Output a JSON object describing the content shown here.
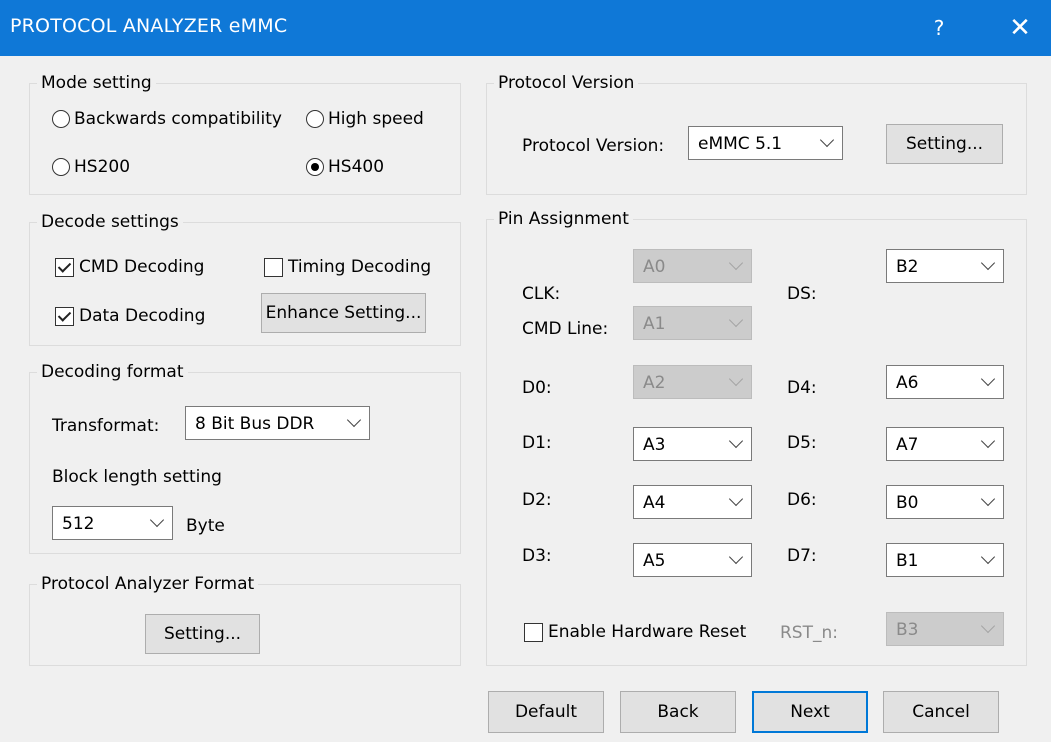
{
  "window": {
    "title": "PROTOCOL ANALYZER eMMC",
    "help_glyph": "?",
    "close_glyph": "✕"
  },
  "mode_setting": {
    "title": "Mode setting",
    "options": [
      "Backwards compatibility",
      "High speed",
      "HS200",
      "HS400"
    ],
    "selected": "HS400"
  },
  "decode_settings": {
    "title": "Decode settings",
    "cmd_decoding": {
      "label": "CMD Decoding",
      "checked": true
    },
    "timing_decoding": {
      "label": "Timing Decoding",
      "checked": false
    },
    "data_decoding": {
      "label": "Data Decoding",
      "checked": true
    },
    "enhance_button": "Enhance Setting..."
  },
  "decoding_format": {
    "title": "Decoding format",
    "transformat_label": "Transformat:",
    "transformat_value": "8 Bit Bus DDR",
    "block_length_label": "Block length setting",
    "block_length_value": "512",
    "block_unit": "Byte"
  },
  "protocol_analyzer_format": {
    "title": "Protocol Analyzer Format",
    "setting_button": "Setting..."
  },
  "protocol_version": {
    "title": "Protocol Version",
    "label": "Protocol Version:",
    "value": "eMMC 5.1",
    "setting_button": "Setting..."
  },
  "pin_assignment": {
    "title": "Pin Assignment",
    "clk": {
      "label": "CLK:",
      "value": "A0"
    },
    "ds": {
      "label": "DS:",
      "value": "B2"
    },
    "cmd_line": {
      "label": "CMD Line:",
      "value": "A1"
    },
    "d0": {
      "label": "D0:",
      "value": "A2"
    },
    "d1": {
      "label": "D1:",
      "value": "A3"
    },
    "d2": {
      "label": "D2:",
      "value": "A4"
    },
    "d3": {
      "label": "D3:",
      "value": "A5"
    },
    "d4": {
      "label": "D4:",
      "value": "A6"
    },
    "d5": {
      "label": "D5:",
      "value": "A7"
    },
    "d6": {
      "label": "D6:",
      "value": "B0"
    },
    "d7": {
      "label": "D7:",
      "value": "B1"
    },
    "enable_hw_reset": {
      "label": "Enable Hardware Reset",
      "checked": false
    },
    "rst_n": {
      "label": "RST_n:",
      "value": "B3"
    }
  },
  "footer": {
    "default": "Default",
    "back": "Back",
    "next": "Next",
    "cancel": "Cancel"
  },
  "colors": {
    "titlebar": "#0f78d7",
    "focus_border": "#0078d7",
    "disabled_combo": "#cccccc"
  }
}
